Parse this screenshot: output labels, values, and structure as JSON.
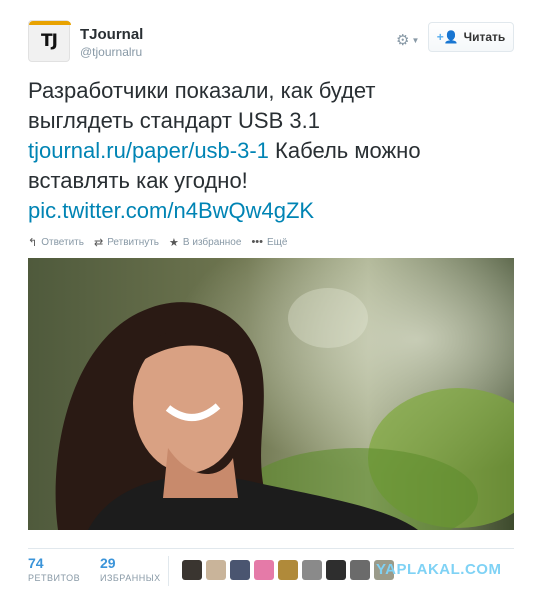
{
  "account": {
    "name": "TJournal",
    "handle": "@tjournalru",
    "avatar_text": "TJ",
    "follow_label": "Читать"
  },
  "tweet": {
    "line1": "Разработчики показали, как будет",
    "line2": "выглядеть стандарт USB 3.1",
    "link1": "tjournal.ru/paper/usb-3-1",
    "line3_rest": " Кабель можно",
    "line4": "вставлять как угодно!",
    "link2": "pic.twitter.com/n4BwQw4gZK"
  },
  "actions": {
    "reply": "Ответить",
    "retweet": "Ретвитнуть",
    "favorite": "В избранное",
    "more": "Ещё"
  },
  "stats": {
    "retweets_count": "74",
    "retweets_label": "РЕТВИТОВ",
    "favorites_count": "29",
    "favorites_label": "ИЗБРАННЫХ"
  },
  "watermark": "YAPLAKAL.COM",
  "colors": {
    "link": "#0084b4",
    "stat": "#3b94d9",
    "muted": "#8899a6"
  }
}
